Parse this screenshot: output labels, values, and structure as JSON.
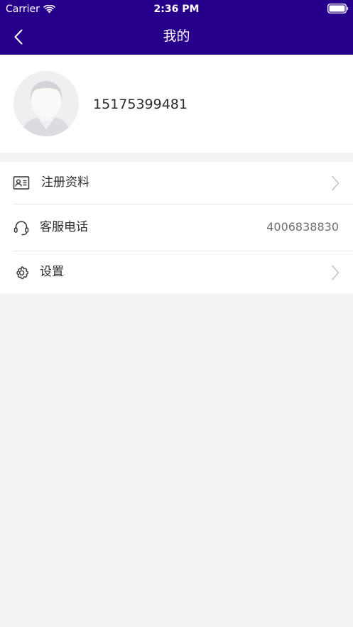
{
  "status_bar": {
    "carrier": "Carrier",
    "time": "2:36 PM"
  },
  "nav": {
    "title": "我的",
    "back_icon": "chevron-left-icon"
  },
  "profile": {
    "phone": "15175399481",
    "avatar_icon": "default-avatar-icon"
  },
  "menu": {
    "items": [
      {
        "label": "注册资料",
        "icon": "id-card-icon",
        "value": "",
        "chevron": true
      },
      {
        "label": "客服电话",
        "icon": "headset-icon",
        "value": "4006838830",
        "chevron": false
      },
      {
        "label": "设置",
        "icon": "gear-icon",
        "value": "",
        "chevron": true
      }
    ]
  },
  "colors": {
    "header_bg": "#26008a",
    "page_bg": "#f3f3f3",
    "card_bg": "#ffffff"
  }
}
